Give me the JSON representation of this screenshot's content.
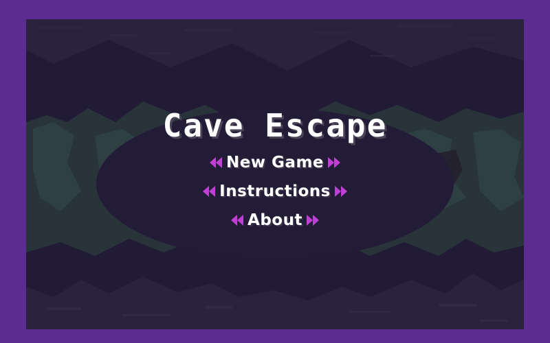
{
  "game": {
    "title": "Cave Escape"
  },
  "menu": {
    "items": [
      {
        "label": "New Game"
      },
      {
        "label": "Instructions"
      },
      {
        "label": "About"
      }
    ]
  },
  "colors": {
    "frame": "#5b2d91",
    "background": "#221b36",
    "arrow": "#c23fd6",
    "text": "#ffffff"
  },
  "icons": {
    "left": "double-chevron-left-icon",
    "right": "double-chevron-right-icon"
  }
}
